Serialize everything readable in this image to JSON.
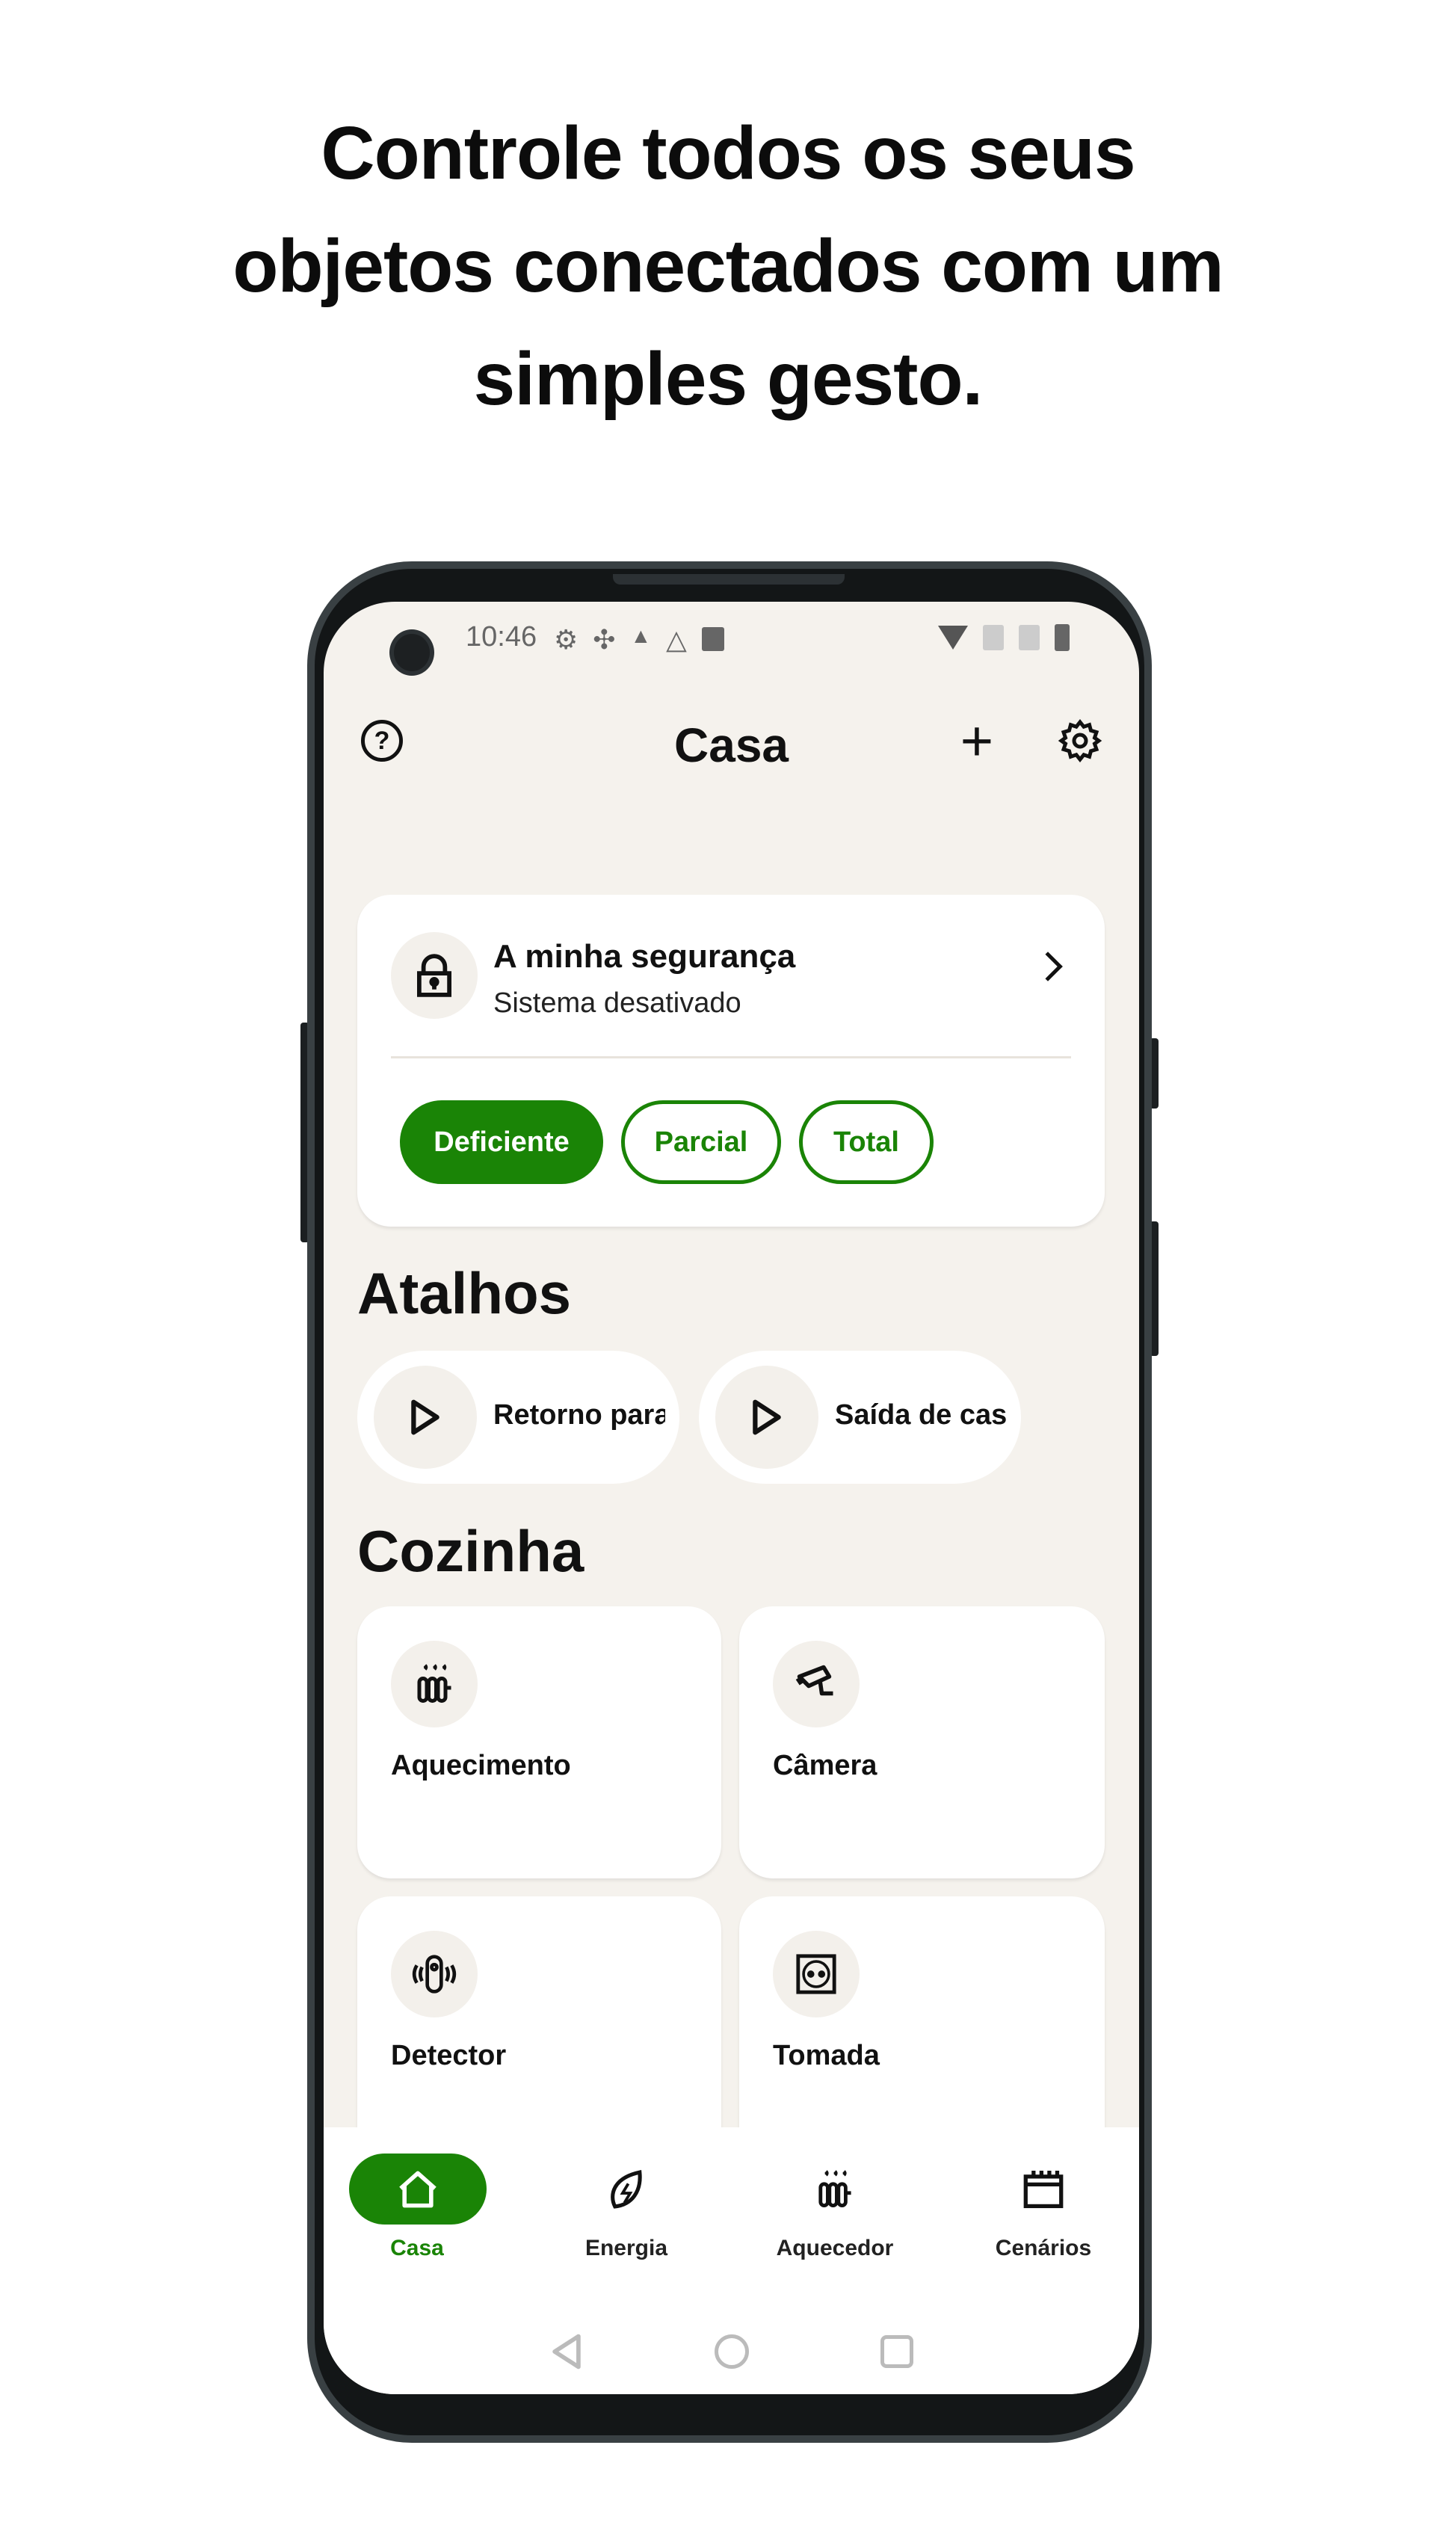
{
  "headline": [
    "Controle todos os seus",
    "objetos conectados com um",
    "simples gesto."
  ],
  "status_bar": {
    "time": "10:46",
    "icons": [
      "gear-icon",
      "slack-icon",
      "drive-icon",
      "drive-outline-icon",
      "image-icon"
    ],
    "right_icons": [
      "wifi-icon",
      "no-sim-icon",
      "no-sim-icon",
      "battery-icon"
    ]
  },
  "header": {
    "title": "Casa",
    "help_icon": "question-circle-icon",
    "add_icon": "plus-icon",
    "settings_icon": "gear-icon"
  },
  "security": {
    "title": "A minha segurança",
    "subtitle": "Sistema desativado",
    "modes": [
      {
        "label": "Deficiente",
        "active": true
      },
      {
        "label": "Parcial",
        "active": false
      },
      {
        "label": "Total",
        "active": false
      }
    ]
  },
  "shortcuts": {
    "title": "Atalhos",
    "items": [
      {
        "label": "Retorno para"
      },
      {
        "label": "Saída de casa"
      }
    ]
  },
  "room": {
    "title": "Cozinha",
    "devices": [
      {
        "label": "Aquecimento",
        "icon": "radiator-icon"
      },
      {
        "label": "Câmera",
        "icon": "camera-icon"
      },
      {
        "label": "Detector",
        "icon": "detector-icon"
      },
      {
        "label": "Tomada",
        "icon": "socket-icon"
      }
    ]
  },
  "bottom_nav": {
    "items": [
      {
        "label": "Casa",
        "icon": "home-icon",
        "active": true
      },
      {
        "label": "Energia",
        "icon": "leaf-icon"
      },
      {
        "label": "Aquecedor",
        "icon": "radiator-icon"
      },
      {
        "label": "Cenários",
        "icon": "calendar-icon"
      }
    ]
  },
  "colors": {
    "accent": "#1a8406",
    "background": "#f5f2ed"
  }
}
